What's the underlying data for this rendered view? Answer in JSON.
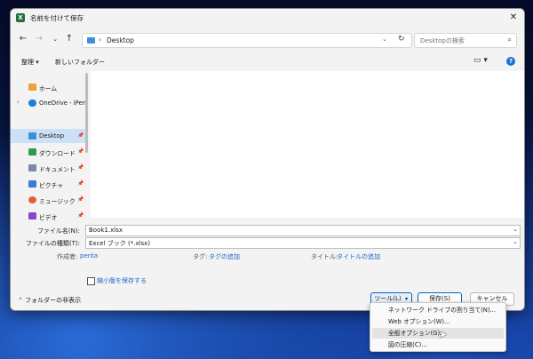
{
  "window": {
    "title": "名前を付けて保存",
    "app_icon_letter": "X"
  },
  "navbar": {
    "back_icon": "arrow-left-icon",
    "forward_icon": "arrow-right-icon",
    "recent_icon": "chevron-down-icon",
    "up_icon": "arrow-up-icon",
    "address": "Desktop",
    "address_sep": "›",
    "search_placeholder": "Desktopの検索"
  },
  "toolbar": {
    "organize_label": "整理 ▾",
    "new_folder_label": "新しいフォルダー"
  },
  "nav_pane": {
    "items": [
      {
        "label": "ホーム",
        "icon": "home-icon",
        "color": "#e8a33b"
      },
      {
        "label": "OneDrive - iPen",
        "icon": "cloud-icon",
        "color": "#1f7fd6"
      },
      {
        "label": "Desktop",
        "icon": "desktop-icon",
        "color": "#3c8fd9"
      },
      {
        "label": "ダウンロード",
        "icon": "download-icon",
        "color": "#2d9b4d"
      },
      {
        "label": "ドキュメント",
        "icon": "document-icon",
        "color": "#7b8aa6"
      },
      {
        "label": "ピクチャ",
        "icon": "picture-icon",
        "color": "#3a7bd5"
      },
      {
        "label": "ミュージック",
        "icon": "music-icon",
        "color": "#e0603a"
      },
      {
        "label": "ビデオ",
        "icon": "video-icon",
        "color": "#8a45c9"
      }
    ]
  },
  "form": {
    "filename_label": "ファイル名(N):",
    "filename_value": "Book1.xlsx",
    "filetype_label": "ファイルの種類(T):",
    "filetype_value": "Excel ブック (*.xlsx)",
    "author_label": "作成者:",
    "author_value": "penta",
    "tags_label": "タグ:",
    "tags_value": "タグの追加",
    "title_label": "タイトル:",
    "title_value": "タイトルの追加",
    "thumbnail_label": "縮小版を保存する"
  },
  "footer": {
    "hide_folders_label": "フォルダーの非表示",
    "tools_label": "ツール(L)",
    "save_label": "保存(S)",
    "cancel_label": "キャンセル"
  },
  "tools_menu": {
    "items": [
      "ネットワーク ドライブの割り当て(N)...",
      "Web オプション(W)...",
      "全般オプション(G)...",
      "図の圧縮(C)..."
    ],
    "hovered_index": 2
  },
  "colors": {
    "accent": "#0067c0",
    "link": "#1a63c7",
    "selected": "#cce1f7"
  }
}
